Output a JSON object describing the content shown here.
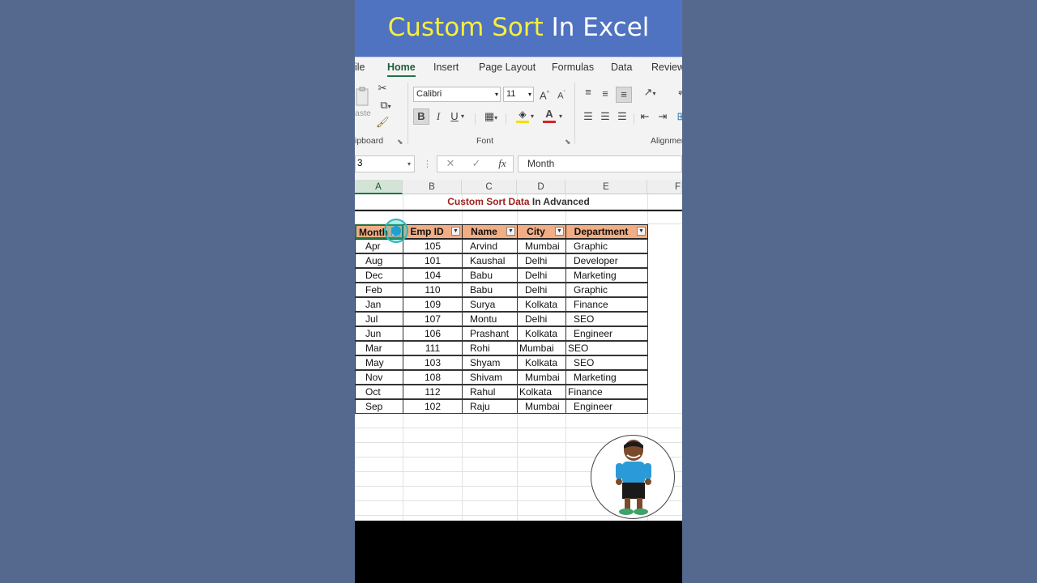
{
  "banner": {
    "highlight": "Custom Sort",
    "rest": " In Excel"
  },
  "tabs": [
    {
      "label": "ile"
    },
    {
      "label": "Home"
    },
    {
      "label": "Insert"
    },
    {
      "label": "Page Layout"
    },
    {
      "label": "Formulas"
    },
    {
      "label": "Data"
    },
    {
      "label": "Review"
    }
  ],
  "ribbon": {
    "paste_label": "aste",
    "clipboard_label": "ipboard",
    "font_name": "Calibri",
    "font_size": "11",
    "font_label": "Font",
    "alignment_label": "Alignmen",
    "bold": "B",
    "italic": "I",
    "underline": "U",
    "grow_font": "A",
    "shrink_font": "A",
    "font_color": "A"
  },
  "formula_bar": {
    "name_box": "3",
    "fx": "fx",
    "value": "Month"
  },
  "columns": [
    "A",
    "B",
    "C",
    "D",
    "E",
    "F"
  ],
  "sheet": {
    "title_red": "Custom Sort Data",
    "title_rest": " In Advanced",
    "headers": [
      "Month",
      "Emp ID",
      "Name",
      "City",
      "Department"
    ],
    "rows": [
      [
        "Apr",
        "105",
        "Arvind",
        "Mumbai",
        "Graphic"
      ],
      [
        "Aug",
        "101",
        "Kaushal",
        "Delhi",
        "Developer"
      ],
      [
        "Dec",
        "104",
        "Babu",
        "Delhi",
        "Marketing"
      ],
      [
        "Feb",
        "110",
        "Babu",
        "Delhi",
        "Graphic"
      ],
      [
        "Jan",
        "109",
        "Surya",
        "Kolkata",
        "Finance"
      ],
      [
        "Jul",
        "107",
        "Montu",
        "Delhi",
        "SEO"
      ],
      [
        "Jun",
        "106",
        "Prashant",
        "Kolkata",
        "Engineer"
      ],
      [
        "Mar",
        "111",
        "Rohi",
        "Mumbai",
        "SEO"
      ],
      [
        "May",
        "103",
        "Shyam",
        "Kolkata",
        "SEO"
      ],
      [
        "Nov",
        "108",
        "Shivam",
        "Mumbai",
        "Marketing"
      ],
      [
        "Oct",
        "112",
        "Rahul",
        "Kolkata",
        "Finance"
      ],
      [
        "Sep",
        "102",
        "Raju",
        "Mumbai",
        "Engineer"
      ]
    ]
  },
  "colors": {
    "banner_bg": "#4f72c1",
    "banner_highlight": "#f6ef3c",
    "header_fill": "#f1ad83",
    "excel_green": "#217346"
  }
}
